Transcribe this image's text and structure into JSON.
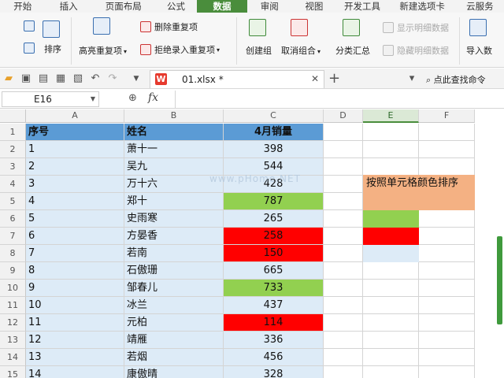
{
  "ribbon_tabs": [
    "开始",
    "插入",
    "页面布局",
    "公式",
    "数据",
    "审阅",
    "视图",
    "开发工具",
    "新建选项卡",
    "云服务"
  ],
  "active_tab": "数据",
  "ribbon": {
    "sort": "排序",
    "highlight_duplicates": "高亮重复项",
    "remove_duplicates": "删除重复项",
    "reject_duplicates": "拒绝录入重复项",
    "create_group": "创建组",
    "ungroup": "取消组合",
    "subtotal": "分类汇总",
    "show_detail": "显示明细数据",
    "hide_detail": "隐藏明细数据",
    "import_data": "导入数"
  },
  "quickbar": {
    "doc_name": "01.xlsx *",
    "wps_letter": "W",
    "find_command": "点此查找命令"
  },
  "formula_bar": {
    "name_box": "E16",
    "fx": "fx",
    "formula": ""
  },
  "columns": [
    "A",
    "B",
    "C",
    "D",
    "E",
    "F"
  ],
  "selected_column": "E",
  "rows": [
    "1",
    "2",
    "3",
    "4",
    "5",
    "6",
    "7",
    "8",
    "9",
    "10",
    "11",
    "12",
    "13",
    "14",
    "15"
  ],
  "table": {
    "headers": [
      "序号",
      "姓名",
      "4月销量"
    ],
    "data": [
      {
        "no": "1",
        "name": "萧十一",
        "sales": "398",
        "color": "blue"
      },
      {
        "no": "2",
        "name": "吴九",
        "sales": "544",
        "color": "blue"
      },
      {
        "no": "3",
        "name": "万十六",
        "sales": "428",
        "color": "blue"
      },
      {
        "no": "4",
        "name": "郑十",
        "sales": "787",
        "color": "green"
      },
      {
        "no": "5",
        "name": "史雨寒",
        "sales": "265",
        "color": "blue"
      },
      {
        "no": "6",
        "name": "方晏香",
        "sales": "258",
        "color": "red"
      },
      {
        "no": "7",
        "name": "若南",
        "sales": "150",
        "color": "red"
      },
      {
        "no": "8",
        "name": "石傲珊",
        "sales": "665",
        "color": "blue"
      },
      {
        "no": "9",
        "name": "邹春儿",
        "sales": "733",
        "color": "green"
      },
      {
        "no": "10",
        "name": "冰兰",
        "sales": "437",
        "color": "blue"
      },
      {
        "no": "11",
        "name": "元柏",
        "sales": "114",
        "color": "red"
      },
      {
        "no": "12",
        "name": "靖雁",
        "sales": "336",
        "color": "blue"
      },
      {
        "no": "13",
        "name": "若烟",
        "sales": "456",
        "color": "blue"
      },
      {
        "no": "14",
        "name": "康傲晴",
        "sales": "328",
        "color": "blue"
      }
    ]
  },
  "note": "按照单元格颜色排序",
  "swatches": [
    "#92d050",
    "#ff0000",
    "#ddebf7"
  ],
  "watermark": "www.pHome.NET",
  "colors": {
    "accent": "#4a8d3c",
    "header_fill": "#5b9bd5",
    "light_blue": "#ddebf7",
    "green": "#92d050",
    "red": "#ff0000",
    "note_fill": "#f4b183"
  }
}
